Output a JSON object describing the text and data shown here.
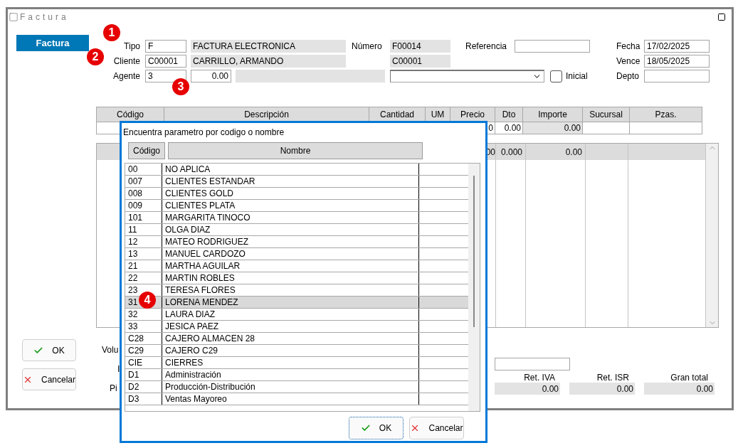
{
  "window": {
    "title": "Factura"
  },
  "side_tab": {
    "label": "Factura",
    "selected": true
  },
  "header": {
    "tipo": {
      "label": "Tipo",
      "code": "F",
      "name": "FACTURA ELECTRONICA"
    },
    "numero": {
      "label": "Número",
      "value": "F00014"
    },
    "referencia": {
      "label": "Referencia"
    },
    "fecha": {
      "label": "Fecha",
      "value": "17/02/2025"
    },
    "cliente": {
      "label": "Cliente",
      "code": "C00001",
      "name": "CARRILLO, ARMANDO",
      "code_copy": "C00001"
    },
    "vence": {
      "label": "Vence",
      "value": "18/05/2025"
    },
    "agente": {
      "label": "Agente",
      "code": "3",
      "amount": "0.00"
    },
    "inicial": {
      "label": "Inicial",
      "checked": false
    },
    "depto": {
      "label": "Depto"
    }
  },
  "items_table": {
    "columns": [
      "Código",
      "Descripción",
      "Cantidad",
      "UM",
      "Precio",
      "Dto",
      "Importe",
      "Sucursal",
      "Pzas."
    ],
    "entry_row": {
      "precio": "0",
      "dto": "0.00",
      "importe": "0.00"
    }
  },
  "lines_grid": {
    "header_row": {
      "precio": "00",
      "dto": "0.000",
      "importe": "0.00"
    }
  },
  "buttons": {
    "ok": "OK",
    "cancel": "Cancelar"
  },
  "partial_labels": [
    "Volu",
    "I",
    "Pi"
  ],
  "totals": [
    {
      "label": "Ret. IVA",
      "value": "0.00"
    },
    {
      "label": "Ret. ISR",
      "value": "0.00"
    },
    {
      "label": "Gran total",
      "value": "0.00"
    }
  ],
  "dialog": {
    "prompt": "Encuentra parametro por codigo o nombre",
    "columns": [
      "Código",
      "Nombre"
    ],
    "rows": [
      {
        "code": "00",
        "name": "NO APLICA",
        "selected": false
      },
      {
        "code": "007",
        "name": "CLIENTES ESTANDAR",
        "selected": false
      },
      {
        "code": "008",
        "name": "CLIENTES GOLD",
        "selected": false
      },
      {
        "code": "009",
        "name": "CLIENTES PLATA",
        "selected": false
      },
      {
        "code": "101",
        "name": "MARGARITA TINOCO",
        "selected": false
      },
      {
        "code": "11",
        "name": "OLGA DIAZ",
        "selected": false
      },
      {
        "code": "12",
        "name": "MATEO RODRIGUEZ",
        "selected": false
      },
      {
        "code": "13",
        "name": "MANUEL CARDOZO",
        "selected": false
      },
      {
        "code": "21",
        "name": "MARTHA AGUILAR",
        "selected": false
      },
      {
        "code": "22",
        "name": "MARTIN ROBLES",
        "selected": false
      },
      {
        "code": "23",
        "name": "TERESA FLORES",
        "selected": false
      },
      {
        "code": "31",
        "name": "LORENA MENDEZ",
        "selected": true
      },
      {
        "code": "32",
        "name": "LAURA DIAZ",
        "selected": false
      },
      {
        "code": "33",
        "name": "JESICA PAEZ",
        "selected": false
      },
      {
        "code": "C28",
        "name": "CAJERO ALMACEN 28",
        "selected": false
      },
      {
        "code": "C29",
        "name": "CAJERO C29",
        "selected": false
      },
      {
        "code": "CIE",
        "name": "CIERRES",
        "selected": false
      },
      {
        "code": "D1",
        "name": "Administración",
        "selected": false
      },
      {
        "code": "D2",
        "name": "Producción-Distribución",
        "selected": false
      },
      {
        "code": "D3",
        "name": "Ventas Mayoreo",
        "selected": false
      }
    ],
    "buttons": {
      "ok": "OK",
      "cancel": "Cancelar"
    }
  },
  "annotations": [
    {
      "label": "1"
    },
    {
      "label": "2"
    },
    {
      "label": "3"
    },
    {
      "label": "4"
    }
  ]
}
